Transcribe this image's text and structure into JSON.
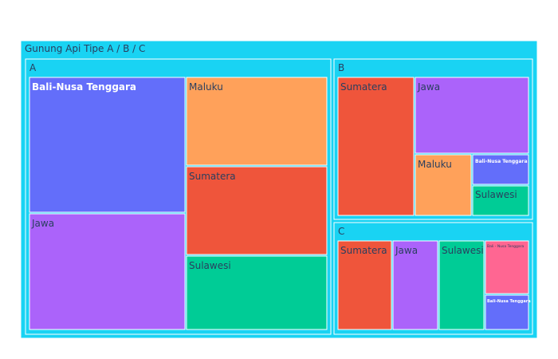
{
  "chart_data": {
    "type": "treemap",
    "root": {
      "label": "Gunung Api Tipe A / B / C",
      "color": "#19d3f3"
    },
    "groups": [
      {
        "label": "A",
        "color": "#19d3f3",
        "children": [
          {
            "label": "Bali-Nusa Tenggara",
            "value": 34,
            "color": "#636efa"
          },
          {
            "label": "Jawa",
            "value": 30,
            "color": "#ab63fa"
          },
          {
            "label": "Maluku",
            "value": 20,
            "color": "#ffa15a"
          },
          {
            "label": "Sumatera",
            "value": 20,
            "color": "#ef553b"
          },
          {
            "label": "Sulawesi",
            "value": 17,
            "color": "#00cc96"
          }
        ]
      },
      {
        "label": "B",
        "color": "#19d3f3",
        "children": [
          {
            "label": "Sumatera",
            "value": 13,
            "color": "#ef553b"
          },
          {
            "label": "Jawa",
            "value": 10,
            "color": "#ab63fa"
          },
          {
            "label": "Maluku",
            "value": 4,
            "color": "#ffa15a"
          },
          {
            "label": "Bali-Nusa Tenggara",
            "value": 1.8,
            "color": "#636efa"
          },
          {
            "label": "Sulawesi",
            "value": 2.2,
            "color": "#00cc96"
          }
        ]
      },
      {
        "label": "C",
        "color": "#19d3f3",
        "children": [
          {
            "label": "Sumatera",
            "value": 6,
            "color": "#ef553b"
          },
          {
            "label": "Jawa",
            "value": 5,
            "color": "#ab63fa"
          },
          {
            "label": "Sulawesi",
            "value": 5,
            "color": "#00cc96"
          },
          {
            "label": "Bali - Nusa Tenggara",
            "value": 3,
            "color": "#ff6692"
          },
          {
            "label": "Bali-Nusa Tenggara",
            "value": 2,
            "color": "#636efa"
          }
        ]
      }
    ]
  }
}
